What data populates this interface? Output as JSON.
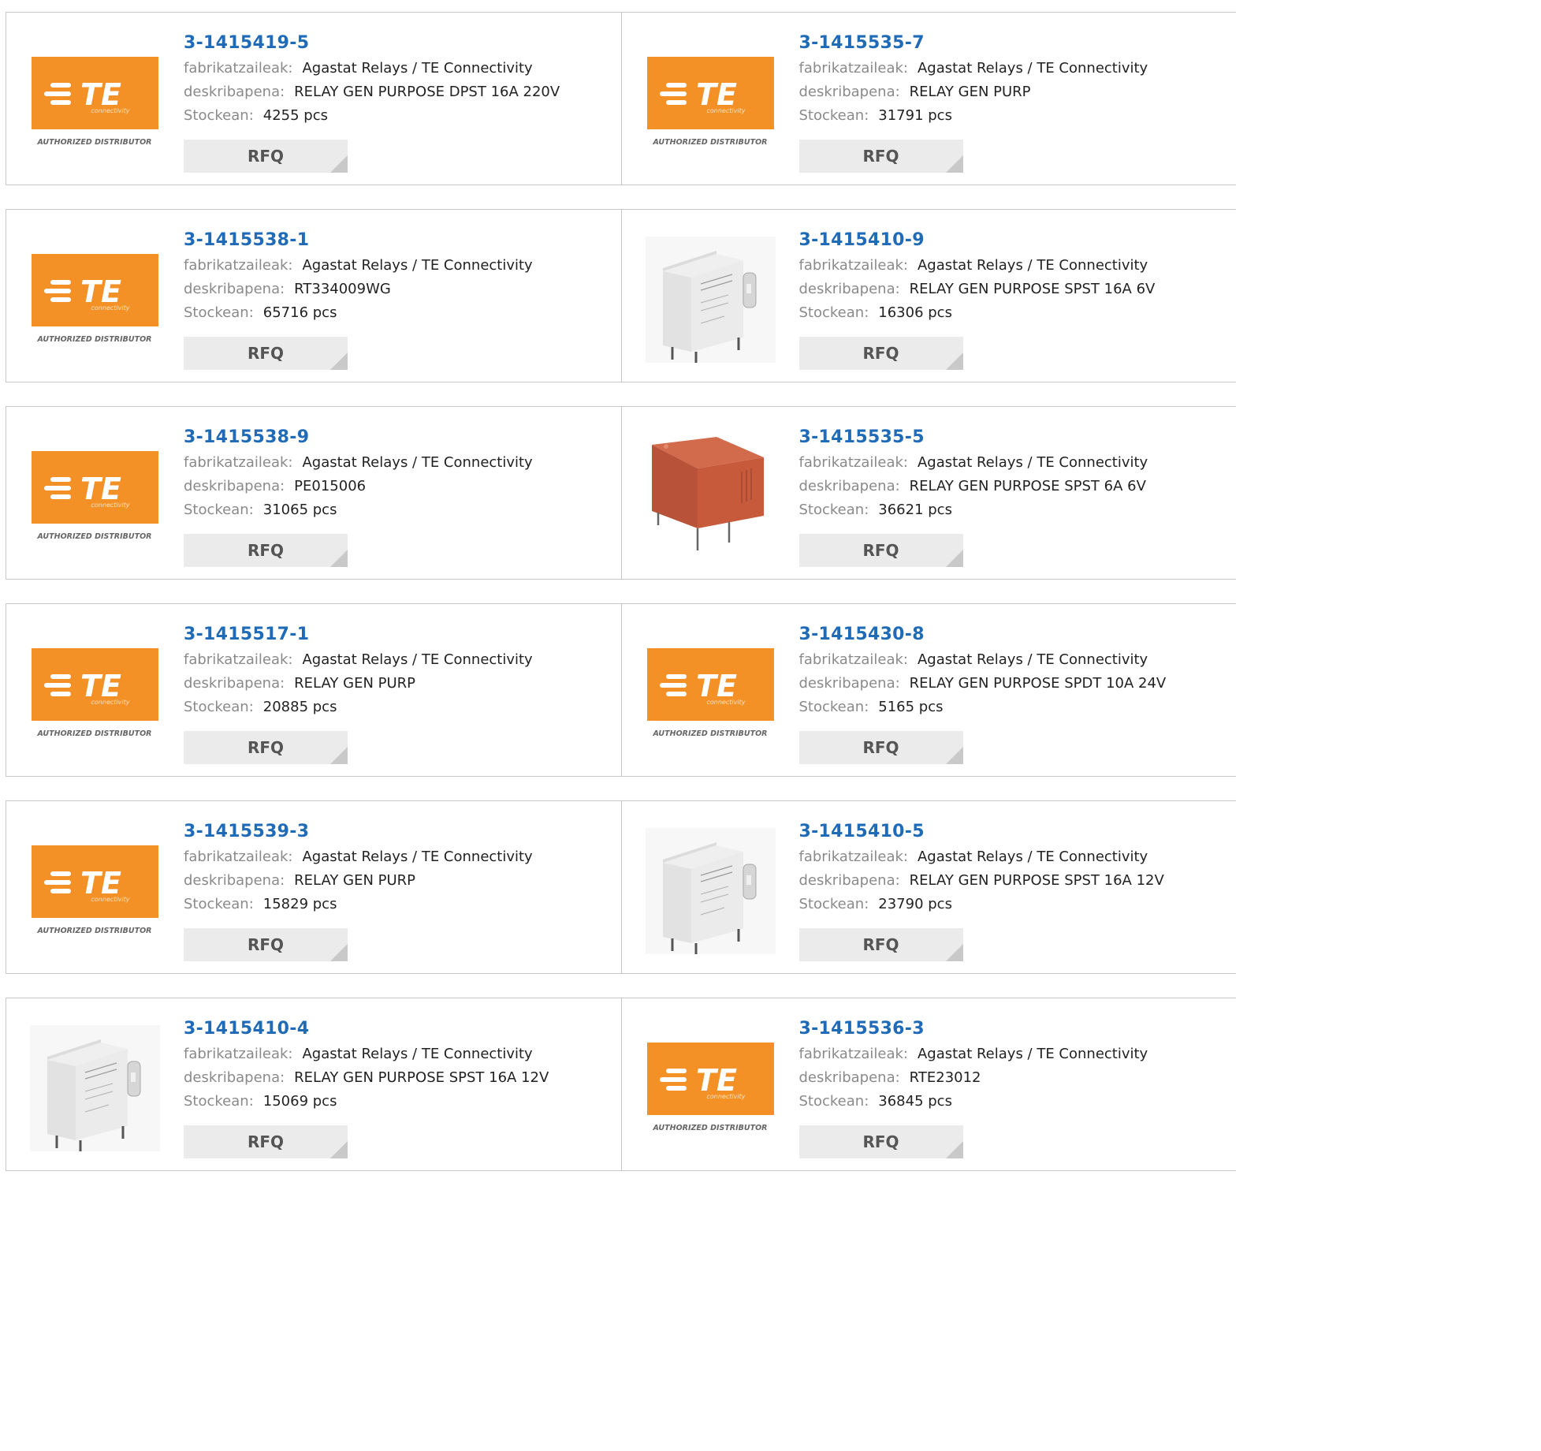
{
  "labels": {
    "manufacturer": "fabrikatzaileak:",
    "description": "deskribapena:",
    "stock": "Stockean:",
    "rfq": "RFQ",
    "logo_brand": "TE",
    "logo_sub": "connectivity",
    "logo_tagline": "AUTHORIZED DISTRIBUTOR"
  },
  "colors": {
    "part_link": "#1f6bb8",
    "te_orange": "#f39126",
    "relay_red": "#c85a3c",
    "border": "#c8c8c8"
  },
  "products": [
    {
      "part": "3-1415419-5",
      "manufacturer": "Agastat Relays / TE Connectivity",
      "description": "RELAY GEN PURPOSE DPST 16A 220V",
      "stock": "4255 pcs",
      "image": "te-logo"
    },
    {
      "part": "3-1415535-7",
      "manufacturer": "Agastat Relays / TE Connectivity",
      "description": "RELAY GEN PURP",
      "stock": "31791 pcs",
      "image": "te-logo"
    },
    {
      "part": "3-1415538-1",
      "manufacturer": "Agastat Relays / TE Connectivity",
      "description": "RT334009WG",
      "stock": "65716 pcs",
      "image": "te-logo"
    },
    {
      "part": "3-1415410-9",
      "manufacturer": "Agastat Relays / TE Connectivity",
      "description": "RELAY GEN PURPOSE SPST 16A 6V",
      "stock": "16306 pcs",
      "image": "relay-white"
    },
    {
      "part": "3-1415538-9",
      "manufacturer": "Agastat Relays / TE Connectivity",
      "description": "PE015006",
      "stock": "31065 pcs",
      "image": "te-logo"
    },
    {
      "part": "3-1415535-5",
      "manufacturer": "Agastat Relays / TE Connectivity",
      "description": "RELAY GEN PURPOSE SPST 6A 6V",
      "stock": "36621 pcs",
      "image": "relay-red"
    },
    {
      "part": "3-1415517-1",
      "manufacturer": "Agastat Relays / TE Connectivity",
      "description": "RELAY GEN PURP",
      "stock": "20885 pcs",
      "image": "te-logo"
    },
    {
      "part": "3-1415430-8",
      "manufacturer": "Agastat Relays / TE Connectivity",
      "description": "RELAY GEN PURPOSE SPDT 10A 24V",
      "stock": "5165 pcs",
      "image": "te-logo"
    },
    {
      "part": "3-1415539-3",
      "manufacturer": "Agastat Relays / TE Connectivity",
      "description": "RELAY GEN PURP",
      "stock": "15829 pcs",
      "image": "te-logo"
    },
    {
      "part": "3-1415410-5",
      "manufacturer": "Agastat Relays / TE Connectivity",
      "description": "RELAY GEN PURPOSE SPST 16A 12V",
      "stock": "23790 pcs",
      "image": "relay-white"
    },
    {
      "part": "3-1415410-4",
      "manufacturer": "Agastat Relays / TE Connectivity",
      "description": "RELAY GEN PURPOSE SPST 16A 12V",
      "stock": "15069 pcs",
      "image": "relay-white"
    },
    {
      "part": "3-1415536-3",
      "manufacturer": "Agastat Relays / TE Connectivity",
      "description": "RTE23012",
      "stock": "36845 pcs",
      "image": "te-logo"
    }
  ]
}
